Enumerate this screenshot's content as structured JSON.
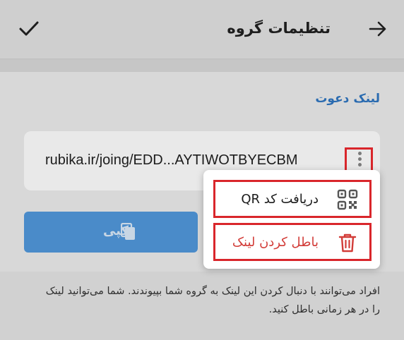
{
  "header": {
    "title": "تنظیمات گروه",
    "back_icon": "arrow-right-icon",
    "confirm_icon": "check-icon"
  },
  "invite": {
    "section_label": "لینک دعوت",
    "link": "rubika.ir/joing/EDD...AYTIWOTBYECBM",
    "more_icon": "more-vertical-icon"
  },
  "actions": {
    "copy_label": "کپی",
    "copy_icon": "copy-icon"
  },
  "menu": {
    "items": [
      {
        "label": "دریافت کد QR",
        "icon": "qr-code-icon"
      },
      {
        "label": "باطل کردن لینک",
        "icon": "trash-icon"
      }
    ]
  },
  "description": "افراد می‌توانند با دنبال کردن این لینک به گروه شما بپیوندند. شما می‌توانید لینک را در هر زمانی باطل کنید.",
  "colors": {
    "accent": "#4a8bc9",
    "label_blue": "#2a6bb0",
    "danger": "#d23c38",
    "highlight": "#d9262b"
  }
}
